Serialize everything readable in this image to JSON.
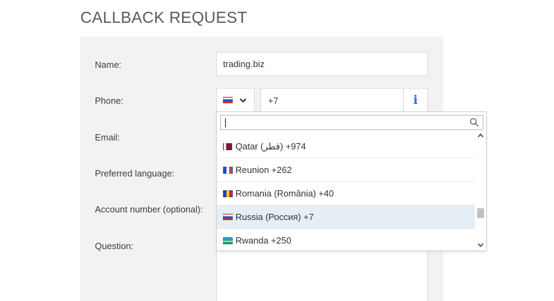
{
  "page": {
    "title": "CALLBACK REQUEST"
  },
  "form": {
    "labels": {
      "name": "Name:",
      "phone": "Phone:",
      "email": "Email:",
      "language": "Preferred language:",
      "account": "Account number (optional):",
      "question": "Question:"
    },
    "name_value": "trading.biz",
    "phone_code": "+7",
    "info_glyph": "i",
    "selected_flag": "flag-russia"
  },
  "country_dropdown": {
    "search_value": "",
    "items": [
      {
        "label": "Qatar (‫قطر‬‎) +974",
        "flag": "flag-qatar"
      },
      {
        "label": "Reunion +262",
        "flag": "flag-reunion"
      },
      {
        "label": "Romania (România) +40",
        "flag": "flag-romania"
      },
      {
        "label": "Russia (Россия) +7",
        "flag": "flag-russia",
        "selected": true
      },
      {
        "label": "Rwanda +250",
        "flag": "flag-rwanda"
      }
    ]
  },
  "colors": {
    "title": "#545b66",
    "panel": "#f2f2f2",
    "info_icon": "#2a6ad6",
    "selected_row": "#e6eef6"
  }
}
